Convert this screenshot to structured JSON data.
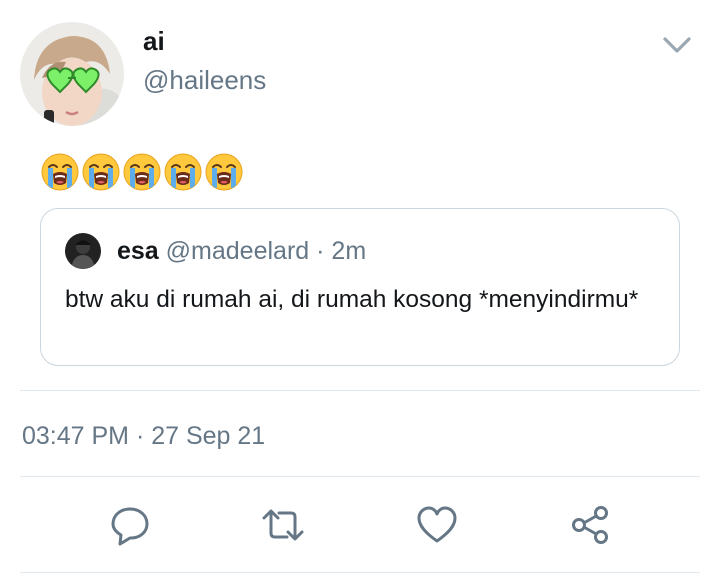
{
  "tweet": {
    "author": {
      "display_name": "ai",
      "handle": "@haileens",
      "avatar": "user-avatar"
    },
    "body_emojis": [
      "loudly-crying-face",
      "loudly-crying-face",
      "loudly-crying-face",
      "loudly-crying-face",
      "loudly-crying-face"
    ],
    "menu_icon": "chevron-down-icon",
    "quoted": {
      "display_name": "esa",
      "handle": "@madeelard",
      "separator": "·",
      "time": "2m",
      "text": "btw aku di rumah ai, di rumah kosong *menyindirmu*"
    },
    "timestamp": "03:47 PM · 27 Sep 21"
  },
  "actions": [
    {
      "name": "reply",
      "icon": "comment-icon"
    },
    {
      "name": "retweet",
      "icon": "retweet-icon"
    },
    {
      "name": "like",
      "icon": "heart-icon"
    },
    {
      "name": "share",
      "icon": "share-icon"
    }
  ],
  "colors": {
    "text": "#14171a",
    "secondary": "#657786",
    "border": "#ccd6dd",
    "divider": "#e1e8ed",
    "emoji_face": "#ffc83d",
    "tears": "#5dadec"
  }
}
